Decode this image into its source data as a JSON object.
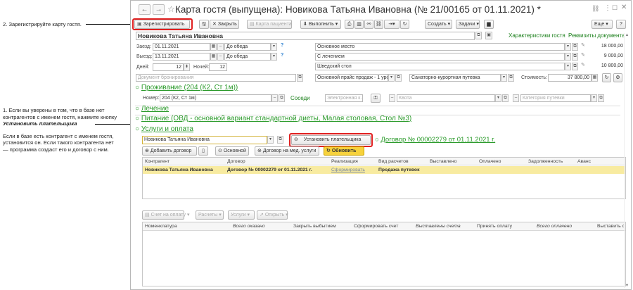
{
  "notes": {
    "step2": "2. Зарегистрируйте карту гостя.",
    "step1_l1": "1. Если вы уверены в том, что в базе нет",
    "step1_l2": "контрагентов с именем гостя, нажмите кнопку",
    "step1_l3": "Установить плательщика",
    "step1_l4": "Если в базе есть контрагент с именем гостя,",
    "step1_l5": "установится он. Если такого контрагента нет",
    "step1_l6": "— программа создаст его и договор с ним."
  },
  "window": {
    "title": "Карта гостя (выпущена): Новикова Татьяна Ивановна (№ 21/00165 от 01.11.2021) *",
    "back": "←",
    "forward": "→",
    "star": "☆"
  },
  "toolbar": {
    "register": "Зарегистрировать",
    "close": "Закрыть",
    "patient_card": "Карта пациента",
    "execute": "Выполнить",
    "create": "Создать",
    "tasks": "Задачи",
    "more": "Еще",
    "help": "?"
  },
  "guest": {
    "name": "Новикова Татьяна Ивановна",
    "characteristics_link": "Характеристики гостя",
    "documents_link": "Реквизиты документа"
  },
  "stay": {
    "arrival_label": "Заезд:",
    "arrival_date": "01.11.2021",
    "arrival_time": "До обеда",
    "departure_label": "Выезд:",
    "departure_date": "13.11.2021",
    "departure_time": "До обеда",
    "days_label": "Дней:",
    "days_value": "12",
    "nights_label": "Ночей:",
    "nights_value": "12",
    "booking_doc_placeholder": "Документ бронирования",
    "option1": "Основное место",
    "option2": "С лечением",
    "option3": "Шведский стол",
    "price1": "18 000,00",
    "price2": "9 000,00",
    "price3": "10 800,00",
    "price_list": "Основной прайс продаж - 1 урс",
    "voucher": "Санаторно-курортная путевка",
    "cost_label": "Стоимость:",
    "cost_value": "37 800,00"
  },
  "accommodation": {
    "header": "Проживание (204 (К2, Ст 1м))",
    "room_label": "Номер:",
    "room_value": "204 (К2, Ст 1м)",
    "neighbors_link": "Соседи",
    "key_placeholder": "Электронная к...",
    "quota_placeholder": "Квота",
    "voucher_category_placeholder": "Категория путевки"
  },
  "treatment": {
    "header": "Лечение"
  },
  "meals": {
    "header": "Питание (ОВД - основной вариант стандартной диеты, Малая столовая, Стол №3)"
  },
  "services": {
    "header": "Услуги и оплата",
    "payer_name": "Новикова Татьяна Ивановна",
    "set_payer": "Установить плательщика",
    "contract_link": "Договор № 00002279 от 01.11.2021 г.",
    "add_contract": "Добавить договор",
    "main_btn": "Основной",
    "med_contract": "Договор на мед. услуги",
    "refresh": "Обновить"
  },
  "contracts_table": {
    "columns": [
      "Контрагент",
      "Договор",
      "Реализация",
      "Вид расчетов",
      "Выставлено",
      "Оплачено",
      "Задолженность",
      "Аванс"
    ],
    "row": {
      "counterparty": "Новикова Татьяна Ивановна",
      "contract": "Договор № 00002279 от 01.11.2021 г.",
      "realization": "Сформировать",
      "payment_type": "Продажа путевок"
    }
  },
  "invoice_toolbar": {
    "invoice": "Счет на оплату",
    "calculations": "Расчеты",
    "services": "Услуги",
    "open": "Открыть"
  },
  "items_table": {
    "columns": [
      "Номенклатура",
      "Всего оказано",
      "Закрыть выбытием",
      "Сформировать счет",
      "Выставлены счета",
      "Принять оплату",
      "Всего оплачено",
      "Выставить с"
    ]
  },
  "colors": {
    "accent_green": "#2a9a2a",
    "highlight_yellow": "#f8eba0",
    "callout_red": "#e02020"
  }
}
